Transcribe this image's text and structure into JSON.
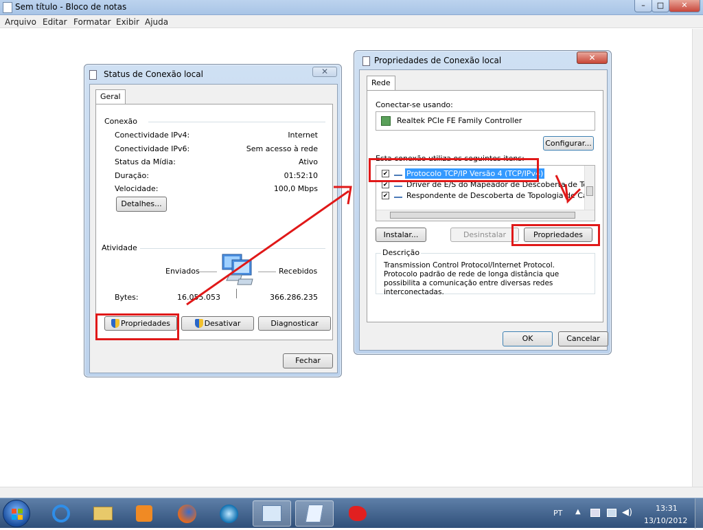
{
  "notepad": {
    "title": "Sem título - Bloco de notas",
    "menu": [
      "Arquivo",
      "Editar",
      "Formatar",
      "Exibir",
      "Ajuda"
    ],
    "min_symbol": "–",
    "max_symbol": "□",
    "close_symbol": "✕"
  },
  "status_dialog": {
    "title": "Status de Conexão local",
    "close_symbol": "✕",
    "tab": "Geral",
    "conexao_label": "Conexão",
    "rows": [
      {
        "label": "Conectividade IPv4:",
        "value": "Internet"
      },
      {
        "label": "Conectividade IPv6:",
        "value": "Sem acesso à rede"
      },
      {
        "label": "Status da Mídia:",
        "value": "Ativo"
      },
      {
        "label": "Duração:",
        "value": "01:52:10"
      },
      {
        "label": "Velocidade:",
        "value": "100,0 Mbps"
      }
    ],
    "detalhes_button": "Detalhes...",
    "atividade_label": "Atividade",
    "enviados_label": "Enviados",
    "recebidos_label": "Recebidos",
    "bytes_label": "Bytes:",
    "bytes_sent": "16.055.053",
    "bytes_received": "366.286.235",
    "propriedades_button": "Propriedades",
    "desativar_button": "Desativar",
    "diagnosticar_button": "Diagnosticar",
    "fechar_button": "Fechar"
  },
  "props_dialog": {
    "title": "Propriedades de Conexão local",
    "close_symbol": "✕",
    "tab": "Rede",
    "conectar_label": "Conectar-se usando:",
    "adapter": "Realtek PCIe FE Family Controller",
    "configurar_button": "Configurar...",
    "items_label": "Esta conexão utiliza os seguintes itens:",
    "items": [
      {
        "label": "Protocolo TCP/IP Versão 4 (TCP/IPv4)",
        "checked": true,
        "selected": true
      },
      {
        "label": "Driver de E/S do Mapeador de Descoberta de Topologia",
        "checked": true,
        "selected": false
      },
      {
        "label": "Respondente de Descoberta de Topologia de Camada",
        "checked": true,
        "selected": false
      }
    ],
    "instalar_button": "Instalar...",
    "desinstalar_button": "Desinstalar",
    "propriedades_button": "Propriedades",
    "descricao_label": "Descrição",
    "descricao_text": "Transmission Control Protocol/Internet Protocol. Protocolo padrão de rede de longa distância que possibilita a comunicação entre diversas redes interconectadas.",
    "ok_button": "OK",
    "cancelar_button": "Cancelar"
  },
  "taskbar": {
    "apps": [
      "internet-explorer",
      "windows-explorer",
      "media-player",
      "firefox",
      "other-browser",
      "control-panel",
      "notepad",
      "paint"
    ],
    "language": "PT",
    "time": "13:31",
    "date": "13/10/2012"
  },
  "annotations_color": "#e01818"
}
